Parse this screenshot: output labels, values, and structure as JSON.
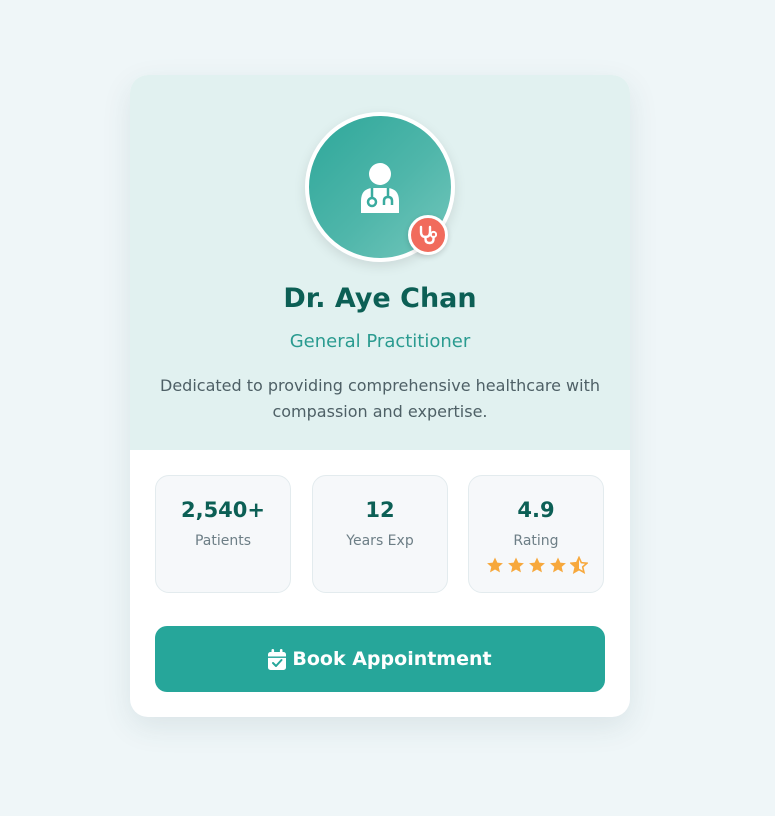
{
  "doctor": {
    "name": "Dr. Aye Chan",
    "specialty": "General Practitioner",
    "bio": "Dedicated to providing comprehensive healthcare with compassion and expertise."
  },
  "stats": [
    {
      "value": "2,540+",
      "label": "Patients"
    },
    {
      "value": "12",
      "label": "Years Exp"
    },
    {
      "value": "4.9",
      "label": "Rating"
    }
  ],
  "rating_stars": 4.5,
  "book_button": {
    "label": "Book Appointment"
  },
  "icons": {
    "avatar": "doctor-user-icon",
    "badge": "stethoscope-icon",
    "button": "calendar-check-icon",
    "rating": "star-icon"
  },
  "colors": {
    "primary": "#26a69a",
    "heading": "#0c5f55",
    "accent": "#f16b5c",
    "star": "#f7a83c"
  }
}
